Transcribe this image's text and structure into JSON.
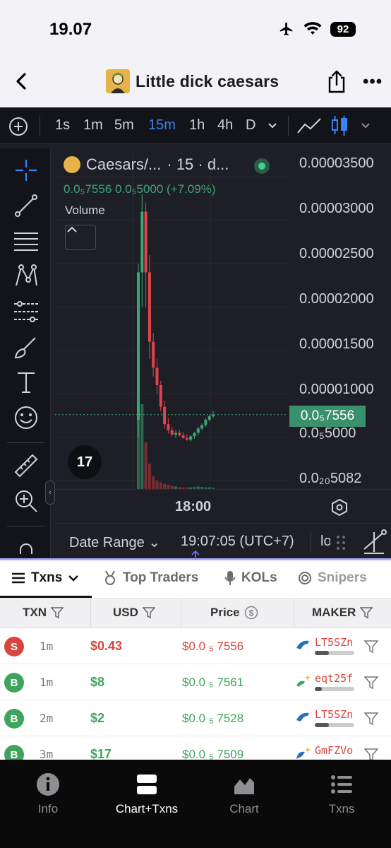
{
  "status": {
    "time": "19.07",
    "battery": "92"
  },
  "header": {
    "title": "Little dick caesars"
  },
  "toolbar": {
    "timeframes": [
      "1s",
      "1m",
      "5m",
      "15m",
      "1h",
      "4h",
      "D"
    ],
    "active_timeframe": "15m"
  },
  "chart": {
    "symbol": "Caesars/...",
    "interval": "· 15 · d...",
    "ohlc_text": "0.0₅7556  0.0₅5000 (+7.09%)",
    "volume_label": "Volume",
    "current_price_tag": "0.0₅7556",
    "x_label": "18:00",
    "logo": "17",
    "date_range": "Date Range",
    "clock": "19:07:05 (UTC+7)",
    "log_label": "lo"
  },
  "chart_data": {
    "type": "bar",
    "title": "",
    "y_tick_labels": [
      "0.00003500",
      "0.00003000",
      "0.00002500",
      "0.00002000",
      "0.00001500",
      "0.00001000",
      "0.0₅5000",
      "0.0₂₀5082"
    ],
    "y_tick_values": [
      3.5e-05,
      3e-05,
      2.5e-05,
      2e-05,
      1.5e-05,
      1e-05,
      5e-06,
      0
    ],
    "x_ticks": [
      "18:00"
    ],
    "ylim": [
      0,
      3.65e-05
    ],
    "series": [
      {
        "type": "candlestick",
        "ohlc": [
          [
            7e-06,
            2.5e-05,
            5e-06,
            2.4e-05
          ],
          [
            2.4e-05,
            3.3e-05,
            2e-05,
            3.1e-05
          ],
          [
            3.1e-05,
            3.2e-05,
            2e-05,
            2.4e-05
          ],
          [
            2.4e-05,
            2.6e-05,
            1.4e-05,
            1.6e-05
          ],
          [
            1.6e-05,
            1.7e-05,
            1.2e-05,
            1.3e-05
          ],
          [
            1.3e-05,
            1.4e-05,
            1e-05,
            1.1e-05
          ],
          [
            1.1e-05,
            1.15e-05,
            8e-06,
            8.5e-06
          ],
          [
            8.5e-06,
            9.2e-06,
            6e-06,
            6.5e-06
          ],
          [
            6.5e-06,
            7.2e-06,
            5.4e-06,
            5.8e-06
          ],
          [
            5.8e-06,
            6.2e-06,
            5.1e-06,
            5.3e-06
          ],
          [
            5.3e-06,
            5.8e-06,
            4.9e-06,
            5.5e-06
          ],
          [
            5.5e-06,
            5.8e-06,
            5.1e-06,
            5.2e-06
          ],
          [
            5.2e-06,
            5.6e-06,
            4.8e-06,
            4.9e-06
          ],
          [
            4.9e-06,
            5.3e-06,
            4.6e-06,
            4.7e-06
          ],
          [
            4.7e-06,
            5.2e-06,
            4.5e-06,
            5.1e-06
          ],
          [
            5.1e-06,
            5.6e-06,
            4.8e-06,
            5.5e-06
          ],
          [
            5.5e-06,
            6.2e-06,
            5.2e-06,
            6e-06
          ],
          [
            6e-06,
            6.6e-06,
            5.8e-06,
            6.4e-06
          ],
          [
            6.4e-06,
            7.2e-06,
            6.2e-06,
            7e-06
          ],
          [
            7e-06,
            7.6e-06,
            6.8e-06,
            7.4e-06
          ],
          [
            7.4e-06,
            8e-06,
            7.2e-06,
            7.6e-06
          ]
        ]
      },
      {
        "type": "volume",
        "values": [
          0.9,
          1.0,
          0.55,
          0.3,
          0.15,
          0.1,
          0.08,
          0.06,
          0.05,
          0.04,
          0.03,
          0.025,
          0.02,
          0.02,
          0.02,
          0.025,
          0.03,
          0.025,
          0.02,
          0.02,
          0.015
        ]
      }
    ]
  },
  "tabs": [
    {
      "label": "Txns",
      "icon": "list-icon",
      "active": true
    },
    {
      "label": "Top Traders",
      "icon": "medal-icon",
      "active": false
    },
    {
      "label": "KOLs",
      "icon": "mic-icon",
      "active": false
    },
    {
      "label": "Snipers",
      "icon": "target-icon",
      "active": false
    }
  ],
  "table": {
    "headers": [
      "TXN",
      "USD",
      "Price",
      "MAKER"
    ],
    "rows": [
      {
        "type": "S",
        "side": "sell",
        "age": "1m",
        "usd": "$0.43",
        "price": "$0.0 ₅ 7556",
        "maker": "LT5SZn"
      },
      {
        "type": "B",
        "side": "buy",
        "age": "1m",
        "usd": "$8",
        "price": "$0.0 ₅ 7561",
        "maker": "eqt25f"
      },
      {
        "type": "B",
        "side": "buy",
        "age": "2m",
        "usd": "$2",
        "price": "$0.0 ₅ 7528",
        "maker": "LT5SZn"
      },
      {
        "type": "B",
        "side": "buy",
        "age": "3m",
        "usd": "$17",
        "price": "$0.0 ₅ 7509",
        "maker": "GmFZVo"
      }
    ]
  },
  "tabbar": [
    {
      "label": "Info",
      "icon": "info-icon",
      "active": false
    },
    {
      "label": "Chart+Txns",
      "icon": "split-view-icon",
      "active": true
    },
    {
      "label": "Chart",
      "icon": "area-chart-icon",
      "active": false
    },
    {
      "label": "Txns",
      "icon": "list-icon",
      "active": false
    }
  ],
  "colors": {
    "up": "#3ba675",
    "down": "#e0444a",
    "accent": "#3b82f6",
    "chart_bg": "#1e1f26"
  }
}
